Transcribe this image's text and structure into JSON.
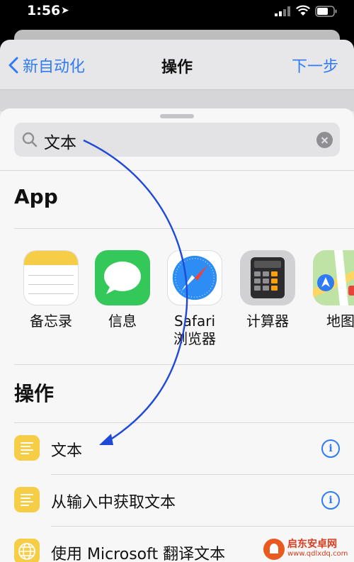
{
  "status_bar": {
    "time": "1:56"
  },
  "nav": {
    "back_label": "新自动化",
    "title": "操作",
    "next_label": "下一步"
  },
  "search": {
    "value": "文本"
  },
  "apps_section": {
    "title": "App",
    "items": [
      {
        "label": "备忘录",
        "icon": "notes-icon"
      },
      {
        "label": "信息",
        "icon": "messages-icon"
      },
      {
        "label": "Safari",
        "label2": "浏览器",
        "icon": "safari-icon"
      },
      {
        "label": "计算器",
        "icon": "calculator-icon"
      },
      {
        "label": "地图",
        "icon": "maps-icon"
      }
    ]
  },
  "actions_section": {
    "title": "操作",
    "rows": [
      {
        "label": "文本"
      },
      {
        "label": "从输入中获取文本"
      },
      {
        "label": "使用 Microsoft 翻译文本"
      }
    ]
  },
  "watermark": {
    "title": "启东安卓网",
    "url": "www.qdlxdq.com"
  },
  "colors": {
    "accent": "#2f7bf6",
    "action_icon": "#f6cd47",
    "arrow": "#1f49d8"
  }
}
